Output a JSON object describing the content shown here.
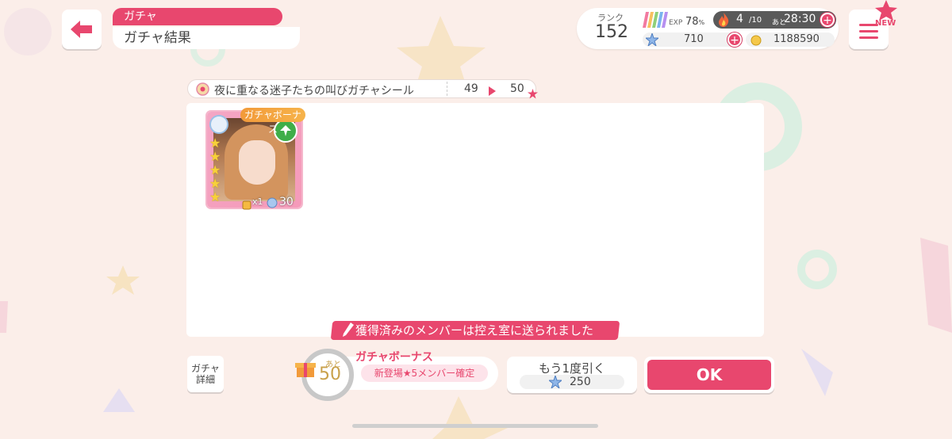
{
  "header": {
    "back_icon": "arrow-left-icon",
    "category": "ガチャ",
    "title": "ガチャ結果"
  },
  "status": {
    "rank_label": "ランク",
    "rank_value": "152",
    "exp_label": "EXP",
    "exp_value": "78",
    "exp_unit": "%",
    "stamina_value": "4",
    "stamina_max": "/10",
    "timer_prefix": "あと",
    "timer_value": "28:30",
    "star_value": "710",
    "coin_value": "1188590"
  },
  "menu": {
    "badge": "NEW"
  },
  "sticker": {
    "name": "夜に重なる迷子たちの叫びガチャシール",
    "from": "49",
    "to": "50"
  },
  "card": {
    "bonus_label": "ガチャボーナス",
    "count": "x1",
    "level": "30",
    "stars": 5
  },
  "acquired_message": "獲得済みのメンバーは控え室に送られました",
  "bottom": {
    "gacha_detail_label_1": "ガチャ",
    "gacha_detail_label_2": "詳細",
    "bonus_title": "ガチャボーナス",
    "bonus_remaining_prefix": "あと",
    "bonus_remaining": "50",
    "bonus_subtitle": "新登場★5メンバー確定",
    "draw_again_label": "もう1度引く",
    "draw_again_cost": "250",
    "ok_label": "OK"
  },
  "colors": {
    "accent": "#e8476e",
    "background": "#fbeee9"
  }
}
